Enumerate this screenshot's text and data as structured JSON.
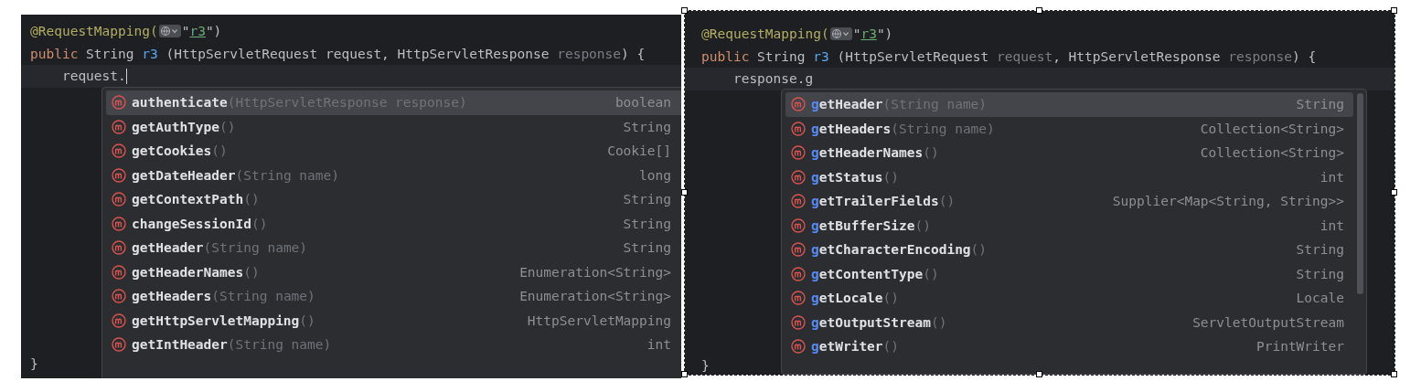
{
  "editors": [
    {
      "code_lines": [
        [
          {
            "kind": "annotation",
            "text": "@RequestMapping("
          },
          {
            "kind": "globe"
          },
          {
            "kind": "plain",
            "text": "\""
          },
          {
            "kind": "string",
            "text": "r3"
          },
          {
            "kind": "plain",
            "text": "\")"
          }
        ],
        [
          {
            "kind": "keyword",
            "text": "public "
          },
          {
            "kind": "plain",
            "text": "String "
          },
          {
            "kind": "method",
            "text": "r3"
          },
          {
            "kind": "plain",
            "text": " (HttpServletRequest request, HttpServletResponse "
          },
          {
            "kind": "dim",
            "text": "response"
          },
          {
            "kind": "plain",
            "text": ") {"
          }
        ],
        [
          {
            "kind": "plain",
            "text": "    request."
          }
        ]
      ],
      "closing_brace": "}",
      "completions": [
        {
          "name": "authenticate",
          "params": "(HttpServletResponse response)",
          "type": "boolean",
          "selected": true
        },
        {
          "name": "getAuthType",
          "params": "()",
          "type": "String",
          "selected": false
        },
        {
          "name": "getCookies",
          "params": "()",
          "type": "Cookie[]",
          "selected": false
        },
        {
          "name": "getDateHeader",
          "params": "(String name)",
          "type": "long",
          "selected": false
        },
        {
          "name": "getContextPath",
          "params": "()",
          "type": "String",
          "selected": false
        },
        {
          "name": "changeSessionId",
          "params": "()",
          "type": "String",
          "selected": false
        },
        {
          "name": "getHeader",
          "params": "(String name)",
          "type": "String",
          "selected": false
        },
        {
          "name": "getHeaderNames",
          "params": "()",
          "type": "Enumeration<String>",
          "selected": false
        },
        {
          "name": "getHeaders",
          "params": "(String name)",
          "type": "Enumeration<String>",
          "selected": false
        },
        {
          "name": "getHttpServletMapping",
          "params": "()",
          "type": "HttpServletMapping",
          "selected": false
        },
        {
          "name": "getIntHeader",
          "params": "(String name)",
          "type": "int",
          "selected": false
        }
      ]
    },
    {
      "code_lines": [
        [
          {
            "kind": "annotation",
            "text": "@RequestMapping("
          },
          {
            "kind": "globe"
          },
          {
            "kind": "plain",
            "text": "\""
          },
          {
            "kind": "string",
            "text": "r3"
          },
          {
            "kind": "plain",
            "text": "\")"
          }
        ],
        [
          {
            "kind": "keyword",
            "text": "public "
          },
          {
            "kind": "plain",
            "text": "String "
          },
          {
            "kind": "method",
            "text": "r3"
          },
          {
            "kind": "plain",
            "text": " (HttpServletRequest "
          },
          {
            "kind": "dim",
            "text": "request"
          },
          {
            "kind": "plain",
            "text": ", HttpServletResponse "
          },
          {
            "kind": "dim",
            "text": "response"
          },
          {
            "kind": "plain",
            "text": ") {"
          }
        ],
        [
          {
            "kind": "plain",
            "text": "    response.g"
          }
        ]
      ],
      "closing_brace": "}",
      "completions": [
        {
          "match": "g",
          "name": "etHeader",
          "params": "(String name)",
          "type": "String",
          "selected": true
        },
        {
          "match": "g",
          "name": "etHeaders",
          "params": "(String name)",
          "type": "Collection<String>",
          "selected": false
        },
        {
          "match": "g",
          "name": "etHeaderNames",
          "params": "()",
          "type": "Collection<String>",
          "selected": false
        },
        {
          "match": "g",
          "name": "etStatus",
          "params": "()",
          "type": "int",
          "selected": false
        },
        {
          "match": "g",
          "name": "etTrailerFields",
          "params": "()",
          "type": "Supplier<Map<String, String>>",
          "selected": false
        },
        {
          "match": "g",
          "name": "etBufferSize",
          "params": "()",
          "type": "int",
          "selected": false
        },
        {
          "match": "g",
          "name": "etCharacterEncoding",
          "params": "()",
          "type": "String",
          "selected": false
        },
        {
          "match": "g",
          "name": "etContentType",
          "params": "()",
          "type": "String",
          "selected": false
        },
        {
          "match": "g",
          "name": "etLocale",
          "params": "()",
          "type": "Locale",
          "selected": false
        },
        {
          "match": "g",
          "name": "etOutputStream",
          "params": "()",
          "type": "ServletOutputStream",
          "selected": false
        },
        {
          "match": "g",
          "name": "etWriter",
          "params": "()",
          "type": "PrintWriter",
          "selected": false
        }
      ]
    }
  ]
}
